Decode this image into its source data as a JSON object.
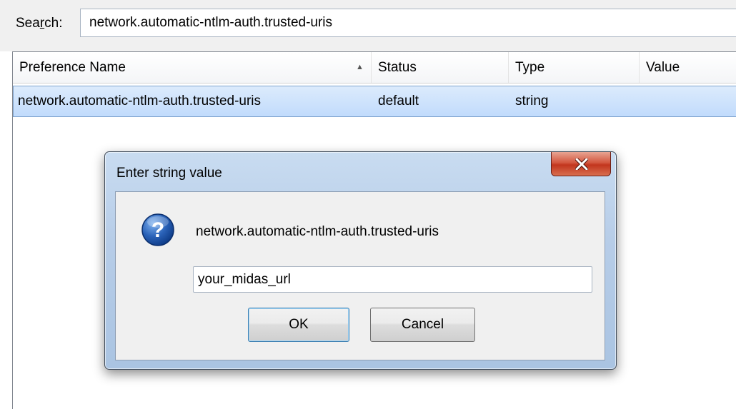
{
  "search": {
    "label_prefix": "Sea",
    "label_accesskey": "r",
    "label_suffix": "ch:",
    "value": "network.automatic-ntlm-auth.trusted-uris"
  },
  "table": {
    "columns": [
      "Preference Name",
      "Status",
      "Type",
      "Value"
    ],
    "sort_indicator": "▲",
    "rows": [
      {
        "name": "network.automatic-ntlm-auth.trusted-uris",
        "status": "default",
        "type": "string",
        "value": ""
      }
    ]
  },
  "dialog": {
    "title": "Enter string value",
    "close_icon": "close-x-icon",
    "icon": "question-icon",
    "message": "network.automatic-ntlm-auth.trusted-uris",
    "input_value": "your_midas_url",
    "ok_label": "OK",
    "cancel_label": "Cancel"
  },
  "colors": {
    "selection": "#c1dbfc",
    "dialog_frame": "#b7cde8",
    "close_button": "#c2361e",
    "icon_blue": "#2a62b8"
  }
}
